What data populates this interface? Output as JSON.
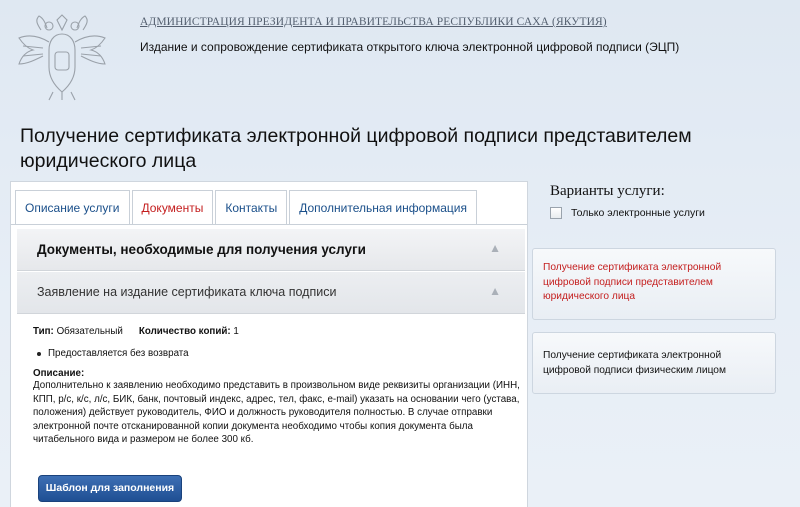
{
  "header": {
    "admin_link": "АДМИНИСТРАЦИЯ ПРЕЗИДЕНТА И ПРАВИТЕЛЬСТВА РЕСПУБЛИКИ САХА (ЯКУТИЯ)",
    "subtitle": "Издание и сопровождение сертификата открытого ключа электронной цифровой подписи (ЭЦП)",
    "emblem_icon": "double-headed-eagle-emblem-icon"
  },
  "page_title": "Получение сертификата электронной цифровой подписи представителем юридического лица",
  "tabs": [
    {
      "label": "Описание услуги"
    },
    {
      "label": "Документы"
    },
    {
      "label": "Контакты"
    },
    {
      "label": "Дополнительная информация"
    }
  ],
  "active_tab_color": "#c41e1e",
  "sections": {
    "documents_header": "Документы, необходимые для получения услуги",
    "document_title": "Заявление на издание сертификата ключа подписи"
  },
  "document": {
    "type_label": "Тип:",
    "type_value": "Обязательный",
    "copies_label": "Количество копий:",
    "copies_value": "1",
    "bullet": "Предоставляется без возврата",
    "description_label": "Описание:",
    "description": "Дополнительно к заявлению необходимо представить в произвольном виде реквизиты организации (ИНН, КПП, р/с, к/с, л/с, БИК, банк, почтовый индекс, адрес, тел, факс, e-mail) указать на основании чего (устава, положения) действует руководитель, ФИО и должность руководителя полностью. В случае отправки электронной почте отсканированной копии документа необходимо чтобы копия документа была читабельного вида и размером не более 300 кб."
  },
  "template_button": "Шаблон для заполнения",
  "sidebar": {
    "title": "Варианты услуги:",
    "checkbox_label": "Только электронные услуги",
    "variants": [
      {
        "label": "Получение сертификата электронной цифровой подписи представителем юридического лица"
      },
      {
        "label": "Получение сертификата электронной цифровой подписи физическим лицом"
      }
    ]
  }
}
